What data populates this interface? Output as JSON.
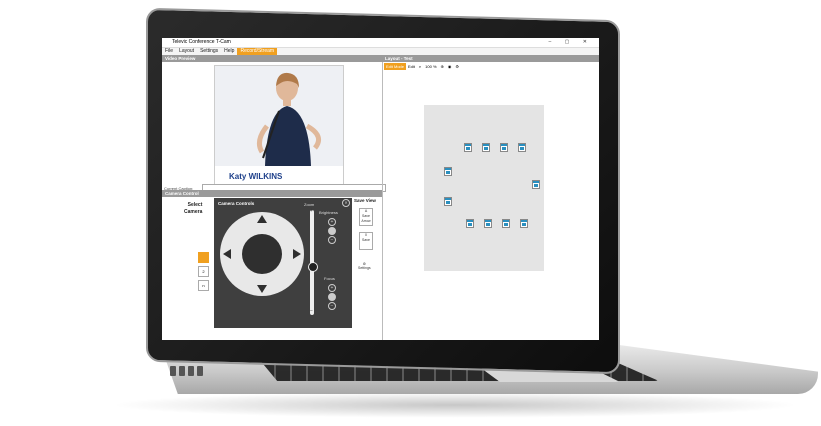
{
  "app": {
    "title": "Televic Conference T-Cam",
    "window_controls": "– ▢ ✕",
    "menu": [
      "File",
      "Layout",
      "Settings",
      "Help",
      "Record/Stream"
    ],
    "active_menu_index": 4
  },
  "video_preview": {
    "header": "Video Preview",
    "speaker_name": "Katy WILKINS",
    "caption_label": "Current Caption:",
    "caption_value": ""
  },
  "camera_control": {
    "header": "Camera Control",
    "select_camera_label": "Select\nCamera",
    "camera_buttons": [
      "",
      "2",
      "n"
    ],
    "panel_title": "Camera Controls",
    "zoom_label": "Zoom",
    "zoom_plus": "+",
    "zoom_minus": "−",
    "brightness_label": "Brightness",
    "focus_label": "Focus",
    "close_glyph": "✕"
  },
  "save_view": {
    "title": "Save View",
    "buttons": [
      {
        "key": "A",
        "label": "Save Arrow"
      },
      {
        "key": "0",
        "label": "Save"
      }
    ],
    "settings_label": "Settings"
  },
  "layout": {
    "header": "Layout - Test",
    "toolbar": [
      "Edit Mode",
      "Edit",
      "100 %"
    ],
    "seat_count": 12
  },
  "colors": {
    "accent": "#f0a020",
    "panel_header": "#9a9a9a",
    "camera_panel": "#3f3f3f",
    "seat_icon": "#2a8fbf"
  }
}
